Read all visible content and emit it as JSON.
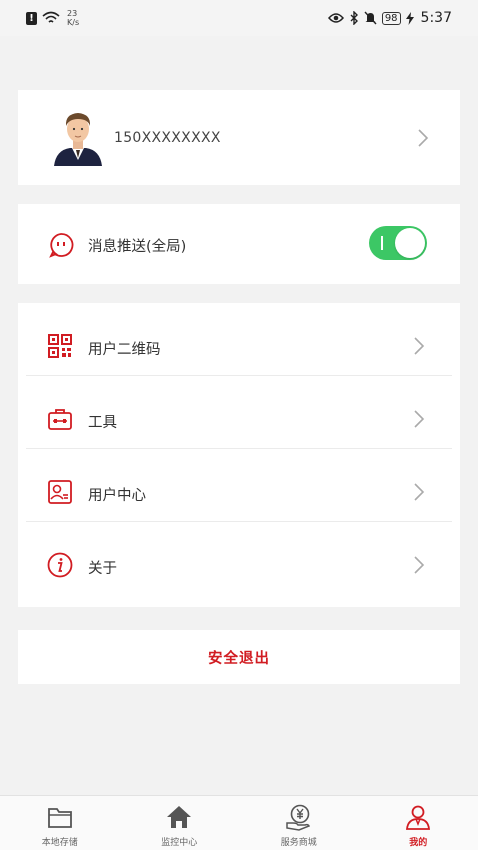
{
  "status_bar": {
    "net_speed_value": "23",
    "net_speed_unit": "K/s",
    "battery": "98",
    "time": "5:37"
  },
  "profile": {
    "phone": "150XXXXXXXX"
  },
  "push": {
    "label": "消息推送(全局)",
    "enabled": true
  },
  "menu": {
    "items": [
      {
        "label": "用户二维码",
        "icon": "qr-code-icon"
      },
      {
        "label": "工具",
        "icon": "toolbox-icon"
      },
      {
        "label": "用户中心",
        "icon": "user-card-icon"
      },
      {
        "label": "关于",
        "icon": "info-icon"
      }
    ]
  },
  "logout": {
    "label": "安全退出"
  },
  "tabs": [
    {
      "label": "本地存储",
      "icon": "folder-icon",
      "active": false
    },
    {
      "label": "监控中心",
      "icon": "home-icon",
      "active": false
    },
    {
      "label": "服务商城",
      "icon": "yuan-hand-icon",
      "active": false
    },
    {
      "label": "我的",
      "icon": "person-icon",
      "active": true
    }
  ],
  "colors": {
    "accent": "#d11c22",
    "toggle_on": "#3cc765",
    "background": "#f2f2f2"
  }
}
